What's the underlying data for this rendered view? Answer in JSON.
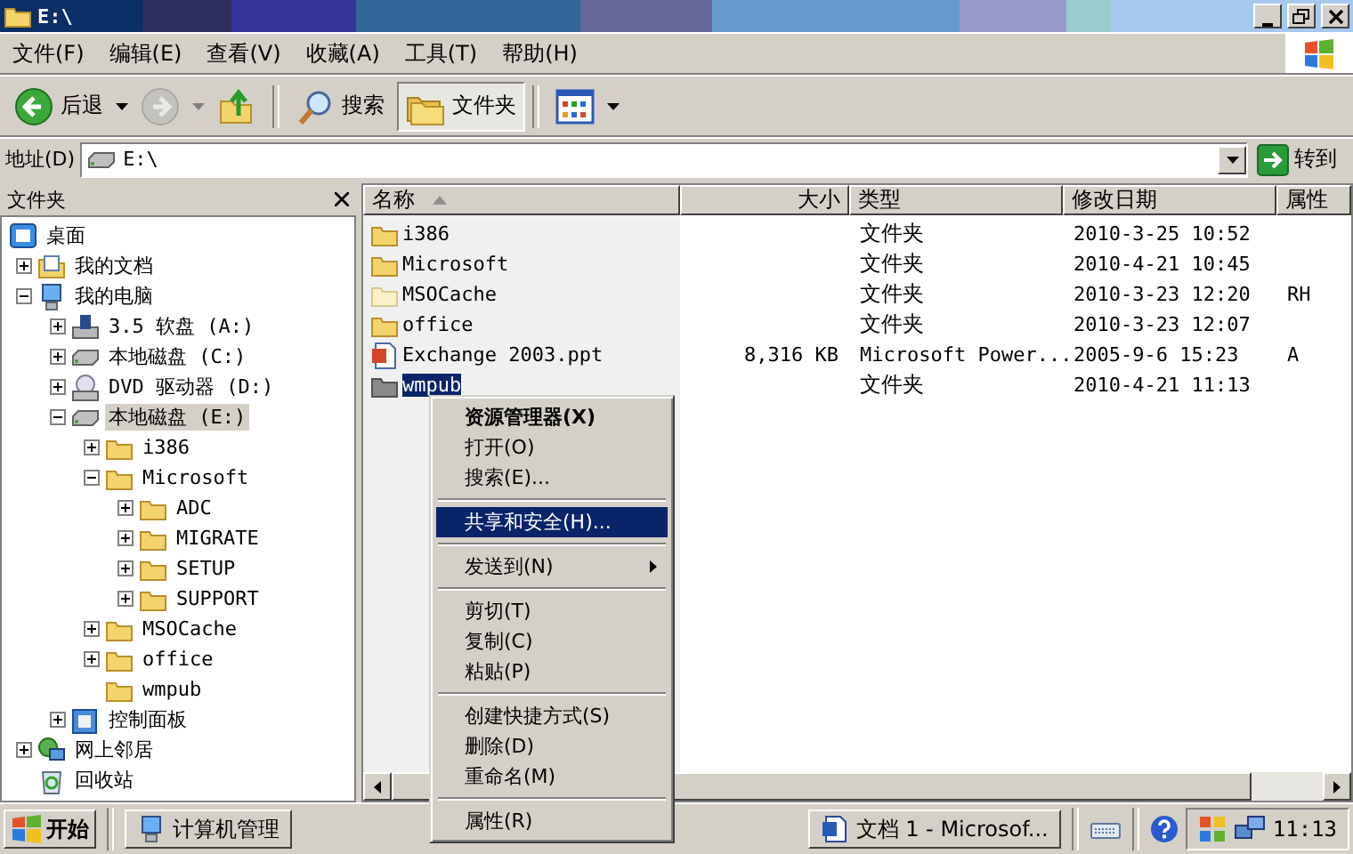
{
  "window": {
    "title": "E:\\"
  },
  "menu_bar": [
    "文件(F)",
    "编辑(E)",
    "查看(V)",
    "收藏(A)",
    "工具(T)",
    "帮助(H)"
  ],
  "toolbar": [
    {
      "kind": "back",
      "label": "后退",
      "dropdown": true,
      "pressed": false,
      "disabled": false
    },
    {
      "kind": "forward",
      "dropdown": true,
      "pressed": false,
      "disabled": true
    },
    {
      "kind": "up",
      "pressed": false,
      "disabled": false
    },
    {
      "kind": "search",
      "label": "搜索",
      "pressed": false,
      "disabled": false
    },
    {
      "kind": "folders",
      "label": "文件夹",
      "pressed": true,
      "disabled": false
    },
    {
      "kind": "views",
      "dropdown": true,
      "pressed": false,
      "disabled": false
    }
  ],
  "address": {
    "label": "地址(D)",
    "value": "E:\\",
    "go_label": "转到"
  },
  "folder_pane": {
    "title": "文件夹",
    "tree": [
      {
        "label": "桌面",
        "kind": "desktop",
        "selected": false,
        "children": [
          {
            "label": "我的文档",
            "kind": "documents",
            "expanded": false,
            "selected": false
          },
          {
            "label": "我的电脑",
            "kind": "computer",
            "expanded": true,
            "selected": false,
            "children": [
              {
                "label": "3.5 软盘 (A:)",
                "kind": "floppy",
                "expanded": false,
                "selected": false
              },
              {
                "label": "本地磁盘 (C:)",
                "kind": "drive",
                "expanded": false,
                "selected": false
              },
              {
                "label": "DVD 驱动器 (D:)",
                "kind": "dvd",
                "expanded": false,
                "selected": false
              },
              {
                "label": "本地磁盘 (E:)",
                "kind": "drive",
                "expanded": true,
                "selected": true,
                "children": [
                  {
                    "label": "i386",
                    "kind": "folder",
                    "expanded": false,
                    "selected": false
                  },
                  {
                    "label": "Microsoft",
                    "kind": "folder",
                    "expanded": true,
                    "selected": false,
                    "children": [
                      {
                        "label": "ADC",
                        "kind": "folder",
                        "expanded": false,
                        "selected": false
                      },
                      {
                        "label": "MIGRATE",
                        "kind": "folder",
                        "expanded": false,
                        "selected": false
                      },
                      {
                        "label": "SETUP",
                        "kind": "folder",
                        "expanded": false,
                        "selected": false
                      },
                      {
                        "label": "SUPPORT",
                        "kind": "folder",
                        "expanded": false,
                        "selected": false
                      }
                    ]
                  },
                  {
                    "label": "MSOCache",
                    "kind": "folder",
                    "expanded": false,
                    "selected": false
                  },
                  {
                    "label": "office",
                    "kind": "folder",
                    "expanded": false,
                    "selected": false
                  },
                  {
                    "label": "wmpub",
                    "kind": "folder",
                    "selected": false
                  }
                ]
              },
              {
                "label": "控制面板",
                "kind": "control-panel",
                "expanded": false,
                "selected": false
              }
            ]
          },
          {
            "label": "网上邻居",
            "kind": "network",
            "expanded": false,
            "selected": false
          },
          {
            "label": "回收站",
            "kind": "recycle-bin",
            "selected": false
          }
        ]
      }
    ]
  },
  "file_list": {
    "columns": [
      {
        "label": "名称",
        "sorted": true
      },
      {
        "label": "大小",
        "sorted": false
      },
      {
        "label": "类型",
        "sorted": false
      },
      {
        "label": "修改日期",
        "sorted": false
      },
      {
        "label": "属性",
        "sorted": false
      }
    ],
    "rows": [
      {
        "name": "i386",
        "kind": "folder",
        "type": "文件夹",
        "modified": "2010-3-25 10:52",
        "selected": false
      },
      {
        "name": "Microsoft",
        "kind": "folder",
        "type": "文件夹",
        "modified": "2010-4-21 10:45",
        "selected": false
      },
      {
        "name": "MSOCache",
        "kind": "hidden-folder",
        "type": "文件夹",
        "modified": "2010-3-23 12:20",
        "attributes": "RH",
        "selected": false
      },
      {
        "name": "office",
        "kind": "folder",
        "type": "文件夹",
        "modified": "2010-3-23 12:07",
        "selected": false
      },
      {
        "name": "Exchange 2003.ppt",
        "kind": "presentation",
        "size": "8,316 KB",
        "type": "Microsoft Power...",
        "modified": "2005-9-6 15:23",
        "attributes": "A",
        "selected": false
      },
      {
        "name": "wmpub",
        "kind": "grey-folder",
        "type": "文件夹",
        "modified": "2010-4-21 11:13",
        "selected": true
      }
    ]
  },
  "context_menu": {
    "items": [
      {
        "kind": "item",
        "label": "资源管理器(X)",
        "default": true,
        "selected": false,
        "submenu": false
      },
      {
        "kind": "item",
        "label": "打开(O)",
        "default": false,
        "selected": false,
        "submenu": false
      },
      {
        "kind": "item",
        "label": "搜索(E)...",
        "default": false,
        "selected": false,
        "submenu": false
      },
      {
        "kind": "separator"
      },
      {
        "kind": "item",
        "label": "共享和安全(H)...",
        "default": false,
        "selected": true,
        "submenu": false
      },
      {
        "kind": "separator"
      },
      {
        "kind": "item",
        "label": "发送到(N)",
        "default": false,
        "selected": false,
        "submenu": true
      },
      {
        "kind": "separator"
      },
      {
        "kind": "item",
        "label": "剪切(T)",
        "default": false,
        "selected": false,
        "submenu": false
      },
      {
        "kind": "item",
        "label": "复制(C)",
        "default": false,
        "selected": false,
        "submenu": false
      },
      {
        "kind": "item",
        "label": "粘贴(P)",
        "default": false,
        "selected": false,
        "submenu": false
      },
      {
        "kind": "separator"
      },
      {
        "kind": "item",
        "label": "创建快捷方式(S)",
        "default": false,
        "selected": false,
        "submenu": false
      },
      {
        "kind": "item",
        "label": "删除(D)",
        "default": false,
        "selected": false,
        "submenu": false
      },
      {
        "kind": "item",
        "label": "重命名(M)",
        "default": false,
        "selected": false,
        "submenu": false
      },
      {
        "kind": "separator"
      },
      {
        "kind": "item",
        "label": "属性(R)",
        "default": false,
        "selected": false,
        "submenu": false
      }
    ]
  },
  "taskbar": {
    "start_label": "开始",
    "tasks": [
      {
        "label": "计算机管理",
        "kind": "computer",
        "selected": false
      },
      {
        "label": "文档 1 - Microsof...",
        "kind": "document",
        "selected": false
      }
    ],
    "clock": "11:13"
  }
}
